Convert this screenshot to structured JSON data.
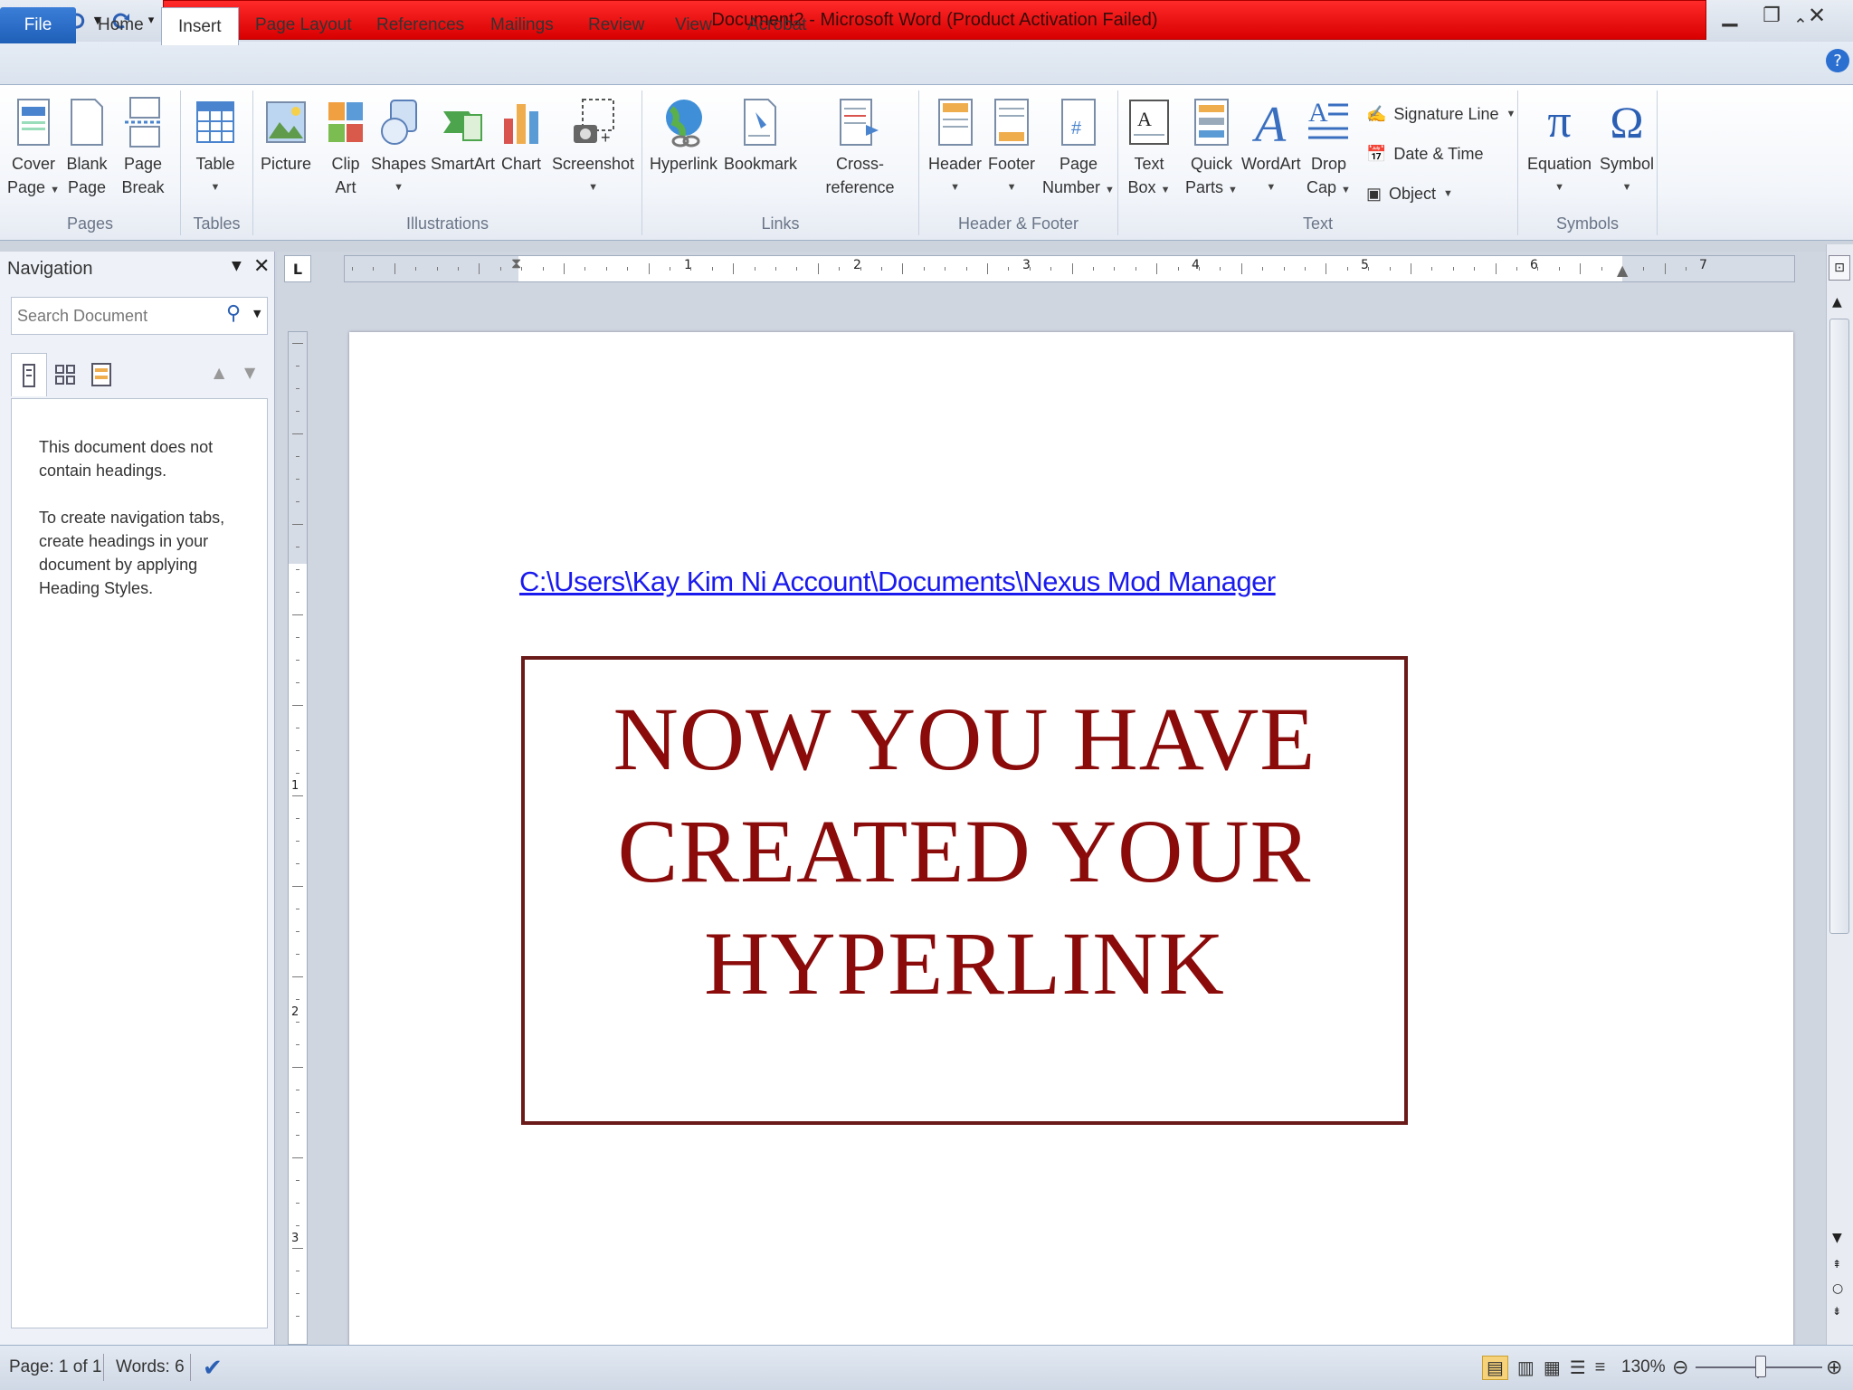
{
  "window": {
    "title": "Document2  -  Microsoft Word (Product Activation Failed)",
    "minimize_icon": "minimize-icon",
    "maximize_icon": "restore-icon",
    "close_icon": "close-icon"
  },
  "tabs": [
    {
      "label": "File"
    },
    {
      "label": "Home"
    },
    {
      "label": "Insert"
    },
    {
      "label": "Page Layout"
    },
    {
      "label": "References"
    },
    {
      "label": "Mailings"
    },
    {
      "label": "Review"
    },
    {
      "label": "View"
    },
    {
      "label": "Acrobat"
    }
  ],
  "ribbon": {
    "pages": {
      "label": "Pages",
      "cover_page": "Cover",
      "cover_page2": "Page",
      "blank_page": "Blank",
      "blank_page2": "Page",
      "page_break": "Page",
      "page_break2": "Break"
    },
    "tables": {
      "label": "Tables",
      "table": "Table"
    },
    "illustrations": {
      "label": "Illustrations",
      "picture": "Picture",
      "clip_art": "Clip",
      "clip_art2": "Art",
      "shapes": "Shapes",
      "smartart": "SmartArt",
      "chart": "Chart",
      "screenshot": "Screenshot"
    },
    "links": {
      "label": "Links",
      "hyperlink": "Hyperlink",
      "bookmark": "Bookmark",
      "cross_reference": "Cross-reference"
    },
    "header_footer": {
      "label": "Header & Footer",
      "header": "Header",
      "footer": "Footer",
      "page_number": "Page",
      "page_number2": "Number"
    },
    "text": {
      "label": "Text",
      "text_box": "Text",
      "text_box2": "Box",
      "quick_parts": "Quick",
      "quick_parts2": "Parts",
      "wordart": "WordArt",
      "drop_cap": "Drop",
      "drop_cap2": "Cap",
      "signature_line": "Signature Line",
      "date_time": "Date & Time",
      "object": "Object"
    },
    "symbols": {
      "label": "Symbols",
      "equation": "Equation",
      "symbol": "Symbol"
    }
  },
  "navigation": {
    "title": "Navigation",
    "search_placeholder": "Search Document",
    "message1a": "This document does not",
    "message1b": "contain headings.",
    "message2a": "To create navigation tabs,",
    "message2b": "create headings in your",
    "message2c": "document by applying",
    "message2d": "Heading Styles."
  },
  "ruler": {
    "numbers": [
      "1",
      "2",
      "3",
      "4",
      "5",
      "6",
      "7"
    ],
    "vnumbers": [
      "1",
      "2",
      "3"
    ]
  },
  "document": {
    "hyperlink": "C:\\Users\\Kay Kim Ni Account\\Documents\\Nexus  Mod Manager",
    "heading_line1": "NOW YOU HAVE",
    "heading_line2": "CREATED YOUR",
    "heading_line3": "HYPERLINK"
  },
  "status": {
    "page": "Page: 1 of 1",
    "words": "Words: 6",
    "zoom": "130%"
  },
  "colors": {
    "title_bar_error": "#e00000",
    "heading_text": "#8b0a0a",
    "hyperlink": "#1a1aee"
  }
}
